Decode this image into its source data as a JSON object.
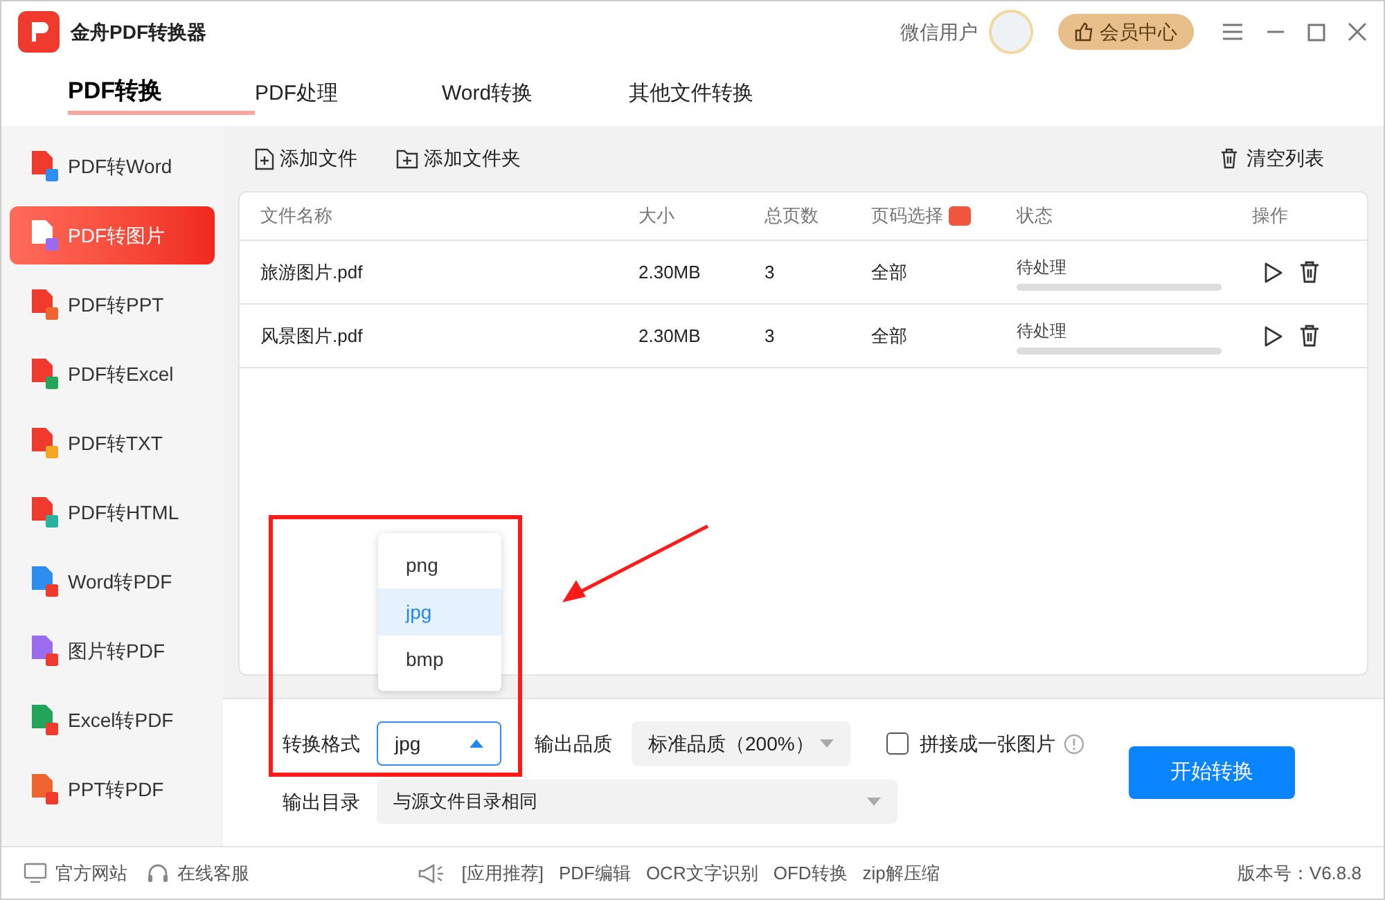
{
  "window": {
    "title": "金舟PDF转换器",
    "user": "微信用户",
    "vip_button": "会员中心"
  },
  "tabs": [
    {
      "label": "PDF转换",
      "selected": true
    },
    {
      "label": "PDF处理",
      "selected": false
    },
    {
      "label": "Word转换",
      "selected": false
    },
    {
      "label": "其他文件转换",
      "selected": false
    }
  ],
  "sidebar": {
    "items": [
      {
        "label": "PDF转Word",
        "selected": false,
        "kind": "from_pdf",
        "color": "#2f8cf0"
      },
      {
        "label": "PDF转图片",
        "selected": true,
        "kind": "from_pdf",
        "color": "#9b6cf0"
      },
      {
        "label": "PDF转PPT",
        "selected": false,
        "kind": "from_pdf",
        "color": "#f0652f"
      },
      {
        "label": "PDF转Excel",
        "selected": false,
        "kind": "from_pdf",
        "color": "#22a45a"
      },
      {
        "label": "PDF转TXT",
        "selected": false,
        "kind": "from_pdf",
        "color": "#f5a623"
      },
      {
        "label": "PDF转HTML",
        "selected": false,
        "kind": "from_pdf",
        "color": "#27b3a0"
      },
      {
        "label": "Word转PDF",
        "selected": false,
        "kind": "to_pdf",
        "color": "#2f8cf0"
      },
      {
        "label": "图片转PDF",
        "selected": false,
        "kind": "to_pdf",
        "color": "#9b6cf0"
      },
      {
        "label": "Excel转PDF",
        "selected": false,
        "kind": "to_pdf",
        "color": "#22a45a"
      },
      {
        "label": "PPT转PDF",
        "selected": false,
        "kind": "to_pdf",
        "color": "#f0652f"
      }
    ]
  },
  "toolbar": {
    "add_file": "添加文件",
    "add_folder": "添加文件夹",
    "clear_list": "清空列表"
  },
  "table": {
    "columns": [
      "文件名称",
      "大小",
      "总页数",
      "页码选择",
      "状态",
      "操作"
    ],
    "rows": [
      {
        "name": "旅游图片.pdf",
        "size": "2.30MB",
        "pages": "3",
        "range": "全部",
        "status": "待处理",
        "level": 0
      },
      {
        "name": "风景图片.pdf",
        "size": "2.30MB",
        "pages": "3",
        "range": "全部",
        "status": "待处理",
        "level": 0
      }
    ]
  },
  "format_menu": {
    "options": [
      {
        "label": "png",
        "selected": false
      },
      {
        "label": "jpg",
        "selected": true
      },
      {
        "label": "bmp",
        "selected": false
      }
    ]
  },
  "settings": {
    "format_label": "转换格式",
    "format_value": "jpg",
    "quality_label": "输出品质",
    "quality_value": "标准品质（200%）",
    "merge_label": "拼接成一张图片",
    "merge_checked": false,
    "output_label": "输出目录",
    "output_value": "与源文件目录相同",
    "start_button": "开始转换"
  },
  "status_bar": {
    "website": "官方网站",
    "support": "在线客服",
    "recommend": "[应用推荐]",
    "links": [
      "PDF编辑",
      "OCR文字识别",
      "OFD转换",
      "zip解压缩"
    ],
    "version": "版本号：V6.8.8"
  }
}
